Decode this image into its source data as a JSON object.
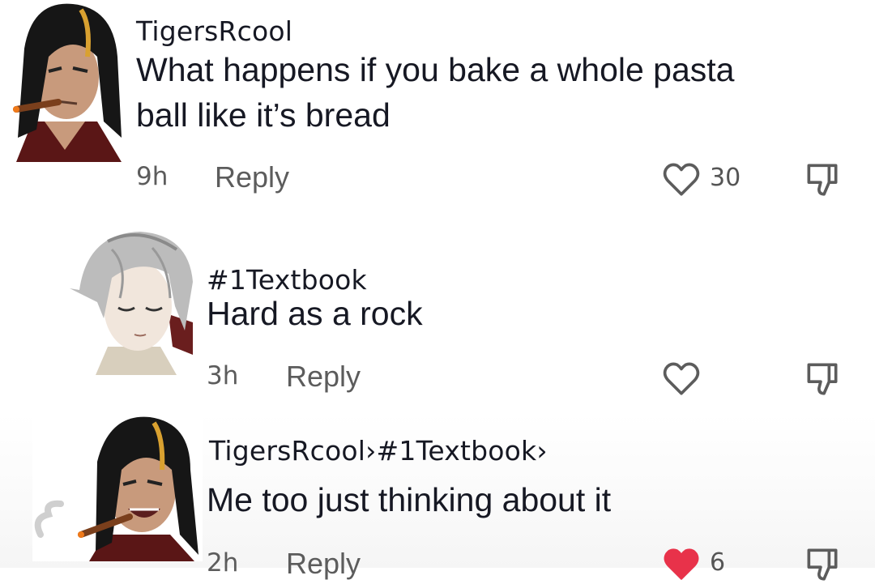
{
  "comments": [
    {
      "username": "TigersRcool",
      "text_line1": "What happens if you bake a whole pasta",
      "text_line2": "ball like it’s bread",
      "time": "9h",
      "reply_label": "Reply",
      "like_count": "30",
      "liked": false,
      "avatar_icon": "cigar-man-avatar"
    },
    {
      "username": "#1Textbook",
      "text_line1": "Hard as a rock",
      "time": "3h",
      "reply_label": "Reply",
      "like_count": "",
      "liked": false,
      "avatar_icon": "silver-hair-avatar"
    },
    {
      "username": "TigersRcool›#1Textbook›",
      "text_line1": "Me too just thinking about it",
      "time": "2h",
      "reply_label": "Reply",
      "like_count": "6",
      "liked": true,
      "avatar_icon": "cigar-man-laughing-avatar"
    }
  ],
  "colors": {
    "text": "#161823",
    "meta": "#5c5c5c",
    "liked_heart": "#e8324a"
  }
}
